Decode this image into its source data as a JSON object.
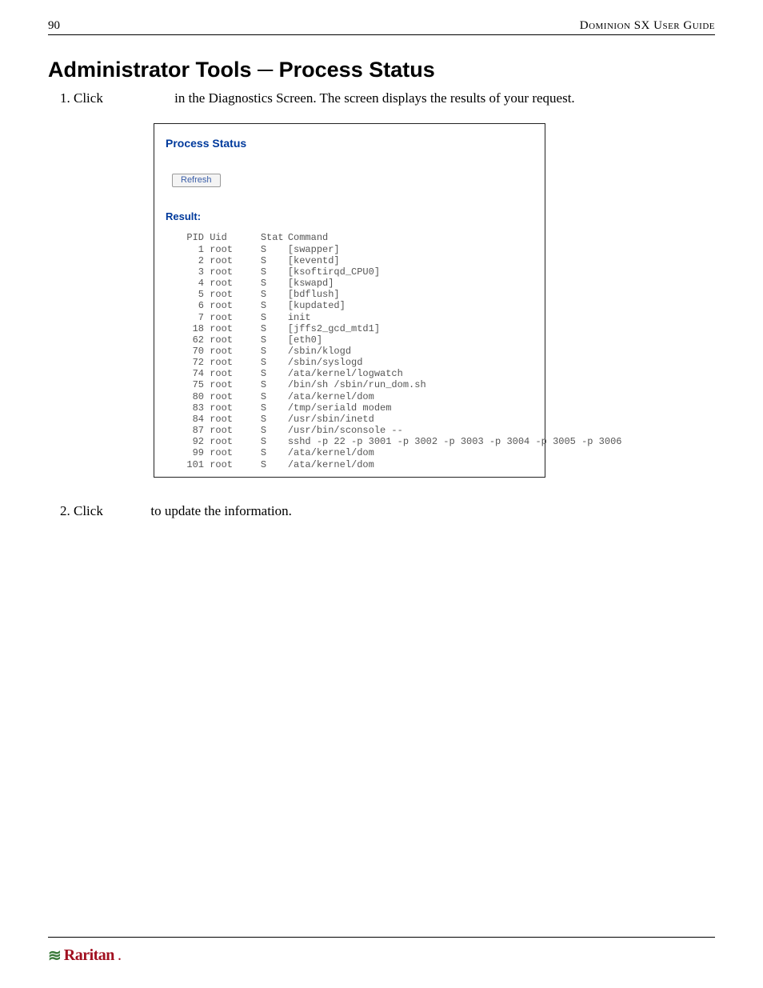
{
  "header": {
    "page_number": "90",
    "guide_title": "Dominion SX User Guide"
  },
  "section_title": "Administrator Tools ─ Process Status",
  "steps": [
    {
      "prefix": "Click",
      "gap": "                     ",
      "rest": "in the Diagnostics Screen. The screen displays the results of your request."
    },
    {
      "prefix": "Click",
      "gap": "              ",
      "rest": "to update the information."
    }
  ],
  "panel": {
    "title": "Process Status",
    "refresh_label": "Refresh",
    "result_label": "Result:",
    "columns": {
      "pid": "PID",
      "uid": "Uid",
      "stat": "Stat",
      "cmd": "Command"
    },
    "rows": [
      {
        "pid": "1",
        "uid": "root",
        "stat": "S",
        "cmd": "[swapper]"
      },
      {
        "pid": "2",
        "uid": "root",
        "stat": "S",
        "cmd": "[keventd]"
      },
      {
        "pid": "3",
        "uid": "root",
        "stat": "S",
        "cmd": "[ksoftirqd_CPU0]"
      },
      {
        "pid": "4",
        "uid": "root",
        "stat": "S",
        "cmd": "[kswapd]"
      },
      {
        "pid": "5",
        "uid": "root",
        "stat": "S",
        "cmd": "[bdflush]"
      },
      {
        "pid": "6",
        "uid": "root",
        "stat": "S",
        "cmd": "[kupdated]"
      },
      {
        "pid": "7",
        "uid": "root",
        "stat": "S",
        "cmd": "init"
      },
      {
        "pid": "18",
        "uid": "root",
        "stat": "S",
        "cmd": "[jffs2_gcd_mtd1]"
      },
      {
        "pid": "62",
        "uid": "root",
        "stat": "S",
        "cmd": "[eth0]"
      },
      {
        "pid": "70",
        "uid": "root",
        "stat": "S",
        "cmd": "/sbin/klogd"
      },
      {
        "pid": "72",
        "uid": "root",
        "stat": "S",
        "cmd": "/sbin/syslogd"
      },
      {
        "pid": "74",
        "uid": "root",
        "stat": "S",
        "cmd": "/ata/kernel/logwatch"
      },
      {
        "pid": "75",
        "uid": "root",
        "stat": "S",
        "cmd": "/bin/sh /sbin/run_dom.sh"
      },
      {
        "pid": "80",
        "uid": "root",
        "stat": "S",
        "cmd": "/ata/kernel/dom"
      },
      {
        "pid": "83",
        "uid": "root",
        "stat": "S",
        "cmd": "/tmp/seriald modem"
      },
      {
        "pid": "84",
        "uid": "root",
        "stat": "S",
        "cmd": "/usr/sbin/inetd"
      },
      {
        "pid": "87",
        "uid": "root",
        "stat": "S",
        "cmd": "/usr/bin/sconsole --"
      },
      {
        "pid": "92",
        "uid": "root",
        "stat": "S",
        "cmd": "sshd -p 22 -p 3001 -p 3002 -p 3003 -p 3004 -p 3005 -p 3006"
      },
      {
        "pid": "99",
        "uid": "root",
        "stat": "S",
        "cmd": "/ata/kernel/dom"
      },
      {
        "pid": "101",
        "uid": "root",
        "stat": "S",
        "cmd": "/ata/kernel/dom"
      }
    ]
  },
  "footer": {
    "brand": "Raritan",
    "dot": "."
  }
}
